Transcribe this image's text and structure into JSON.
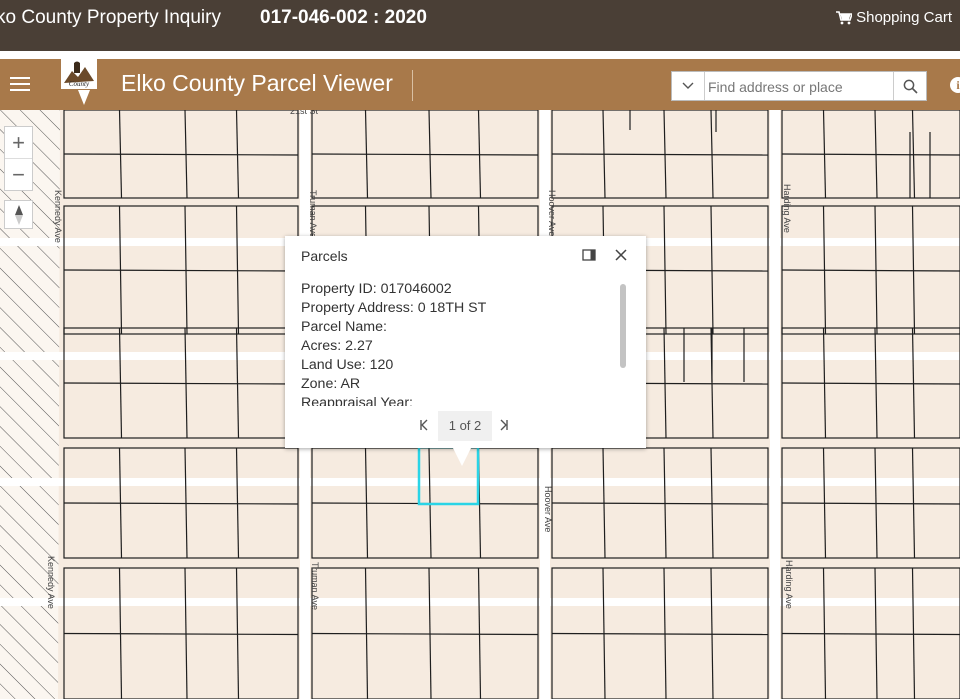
{
  "topbar": {
    "title": "ko County Property Inquiry",
    "parcel_year": "017-046-002 : 2020",
    "cart_label": "Shopping Cart",
    "cart_icon": "cart-icon"
  },
  "header": {
    "menu_icon": "hamburger-menu-icon",
    "app_title": "Elko County Parcel Viewer",
    "search": {
      "placeholder": "Find address or place",
      "value": ""
    },
    "info_icon": "info-icon"
  },
  "map": {
    "zoom_in_label": "+",
    "zoom_out_label": "−",
    "streets": [
      {
        "id": "21st",
        "label": "21st St"
      },
      {
        "id": "kennedy-top",
        "label": "Kennedy Ave"
      },
      {
        "id": "truman-top",
        "label": "Truman Ave"
      },
      {
        "id": "hoover-top",
        "label": "Hoover Ave"
      },
      {
        "id": "harding-top",
        "label": "Harding Ave"
      },
      {
        "id": "hoover-bottom",
        "label": "Hoover Ave"
      },
      {
        "id": "kennedy-bottom",
        "label": "Kennedy Ave"
      },
      {
        "id": "truman-bottom",
        "label": "Truman Ave"
      },
      {
        "id": "harding-bottom",
        "label": "Harding Ave"
      }
    ],
    "highlight_color": "#2ad4e6"
  },
  "popup": {
    "title": "Parcels",
    "fields": [
      "Property ID: 017046002",
      "Property Address: 0 18TH ST",
      "Parcel Name:",
      "Acres: 2.27",
      "Land Use: 120",
      "Zone: AR",
      "Reappraisal Year:"
    ],
    "pager": "1 of 2"
  },
  "colors": {
    "topbar_bg": "#4a3f36",
    "header_bg": "#a8794a",
    "parcel_fill": "#f6ebe0",
    "road": "#ffffff"
  }
}
